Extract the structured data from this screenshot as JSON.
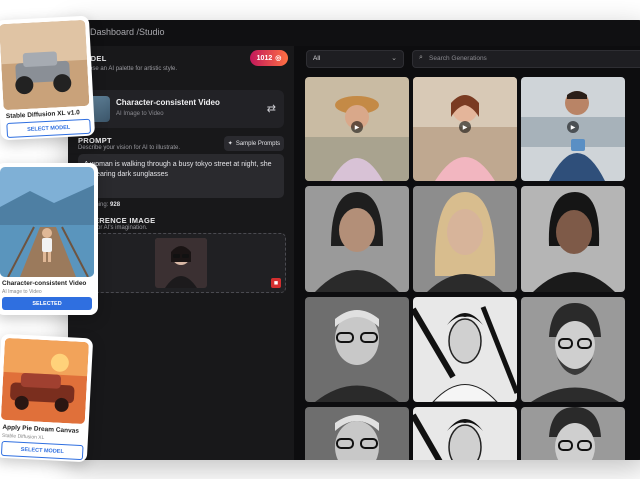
{
  "header": {
    "breadcrumb": "Dashboard /Studio"
  },
  "left_panel": {
    "credits": "1012",
    "model_section": {
      "label": "MODEL",
      "hint": "Choose an AI palette for artistic style."
    },
    "model_card": {
      "title": "Character-consistent Video",
      "subtitle": "AI Image to Video"
    },
    "prompt_section": {
      "label": "PROMPT",
      "hint": "Describe your vision for AI to illustrate.",
      "sample_button": "Sample Prompts"
    },
    "prompt_text": "A woman is walking through a busy tokyo street at night, she is wearing dark sunglasses",
    "remaining": {
      "label": "Remaining:",
      "value": "928"
    },
    "reference_section": {
      "label": "REFERENCE IMAGE",
      "hint": "Spark for AI's imagination."
    }
  },
  "right_panel": {
    "filter_select": {
      "value": "All"
    },
    "search": {
      "placeholder": "Search Generations"
    }
  },
  "floating_cards": [
    {
      "title": "Stable Diffusion XL v1.0",
      "button": "SELECT MODEL"
    },
    {
      "title": "Character-consistent Video",
      "subtitle": "AI Image to Video",
      "button": "SELECTED"
    },
    {
      "title": "Apply Pie Dream Canvas",
      "subtitle": "Stable Diffusion XL",
      "button": "SELECT MODEL"
    }
  ],
  "colors": {
    "accent_blue": "#2f6fe0",
    "credits_gradient_start": "#c2185b",
    "credits_gradient_end": "#ff7043",
    "panel_bg": "#18181a",
    "gallery_bg": "#0d0d0f"
  }
}
